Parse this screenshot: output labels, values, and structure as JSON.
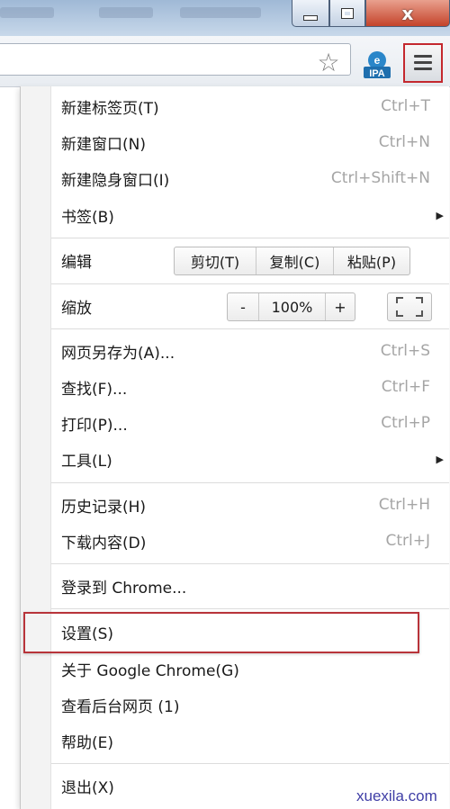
{
  "window": {
    "minimize_icon": "minimize-icon",
    "maximize_icon": "restore-icon",
    "close_glyph": "x"
  },
  "toolbar": {
    "star_icon": "star-icon",
    "extension_icon_text": "IPA",
    "menu_icon": "hamburger-icon"
  },
  "menu": {
    "new_tab": {
      "label": "新建标签页(T)",
      "shortcut": "Ctrl+T"
    },
    "new_window": {
      "label": "新建窗口(N)",
      "shortcut": "Ctrl+N"
    },
    "new_incognito": {
      "label": "新建隐身窗口(I)",
      "shortcut": "Ctrl+Shift+N"
    },
    "bookmarks": {
      "label": "书签(B)"
    },
    "edit": {
      "label": "编辑",
      "cut": "剪切(T)",
      "copy": "复制(C)",
      "paste": "粘贴(P)"
    },
    "zoom": {
      "label": "缩放",
      "minus": "-",
      "value": "100%",
      "plus": "+"
    },
    "save_as": {
      "label": "网页另存为(A)...",
      "shortcut": "Ctrl+S"
    },
    "find": {
      "label": "查找(F)...",
      "shortcut": "Ctrl+F"
    },
    "print": {
      "label": "打印(P)...",
      "shortcut": "Ctrl+P"
    },
    "tools": {
      "label": "工具(L)"
    },
    "history": {
      "label": "历史记录(H)",
      "shortcut": "Ctrl+H"
    },
    "downloads": {
      "label": "下载内容(D)",
      "shortcut": "Ctrl+J"
    },
    "sign_in": {
      "label": "登录到 Chrome..."
    },
    "settings": {
      "label": "设置(S)"
    },
    "about": {
      "label": "关于 Google Chrome(G)"
    },
    "background_pages": {
      "label": "查看后台网页 (1)"
    },
    "help": {
      "label": "帮助(E)"
    },
    "exit": {
      "label": "退出(X)"
    }
  },
  "watermark": "xuexila.com",
  "colors": {
    "highlight_border": "#b8343a",
    "shortcut_text": "#a5a5a5",
    "close_button": "#c4432a"
  }
}
